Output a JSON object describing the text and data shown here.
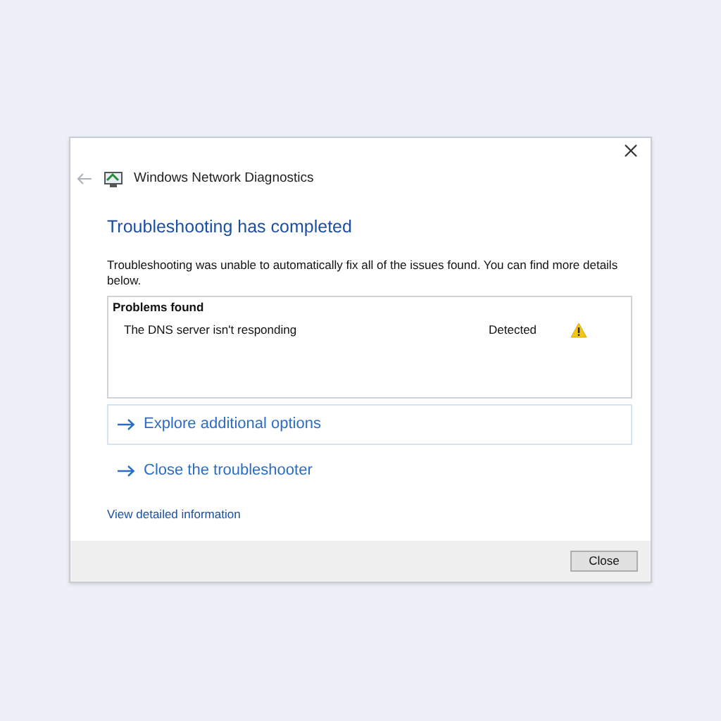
{
  "window": {
    "title": "Windows Network Diagnostics"
  },
  "heading": "Troubleshooting has completed",
  "message": "Troubleshooting was unable to automatically fix all of the issues found. You can find more details below.",
  "problems": {
    "title": "Problems found",
    "rows": [
      {
        "name": "The DNS server isn't responding",
        "status": "Detected",
        "kind": "warning"
      }
    ]
  },
  "options": [
    {
      "label": "Explore additional options",
      "selected": true
    },
    {
      "label": "Close the troubleshooter",
      "selected": false
    }
  ],
  "details_link": "View detailed information",
  "buttons": [
    "Close"
  ]
}
